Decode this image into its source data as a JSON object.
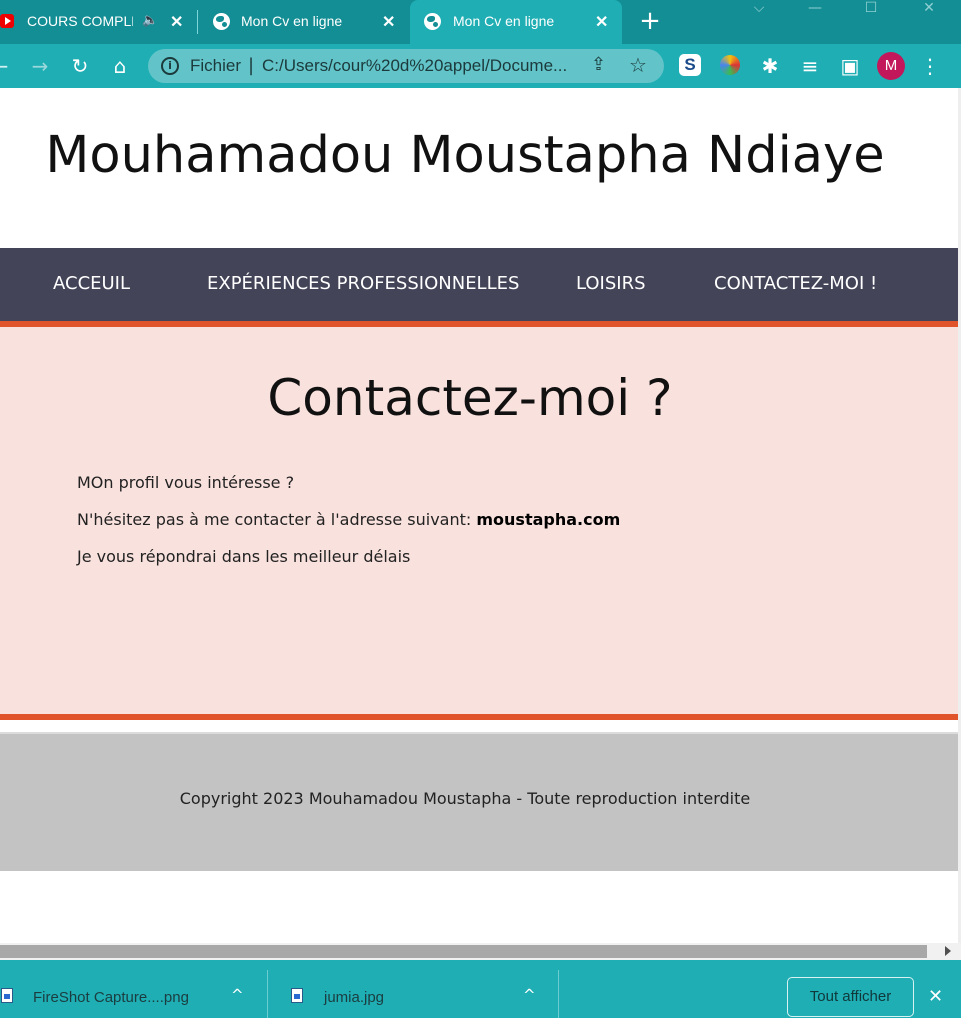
{
  "browser": {
    "tabs": [
      {
        "title": "COURS COMPLE",
        "audio_icon": "🔈",
        "close": "✕",
        "active": false
      },
      {
        "title": "Mon Cv en ligne",
        "close": "✕",
        "active": false
      },
      {
        "title": "Mon Cv en ligne",
        "close": "✕",
        "active": true
      }
    ],
    "new_tab": "+",
    "window_controls": {
      "dropdown": "⌵",
      "minimize": "—",
      "maximize": "☐",
      "close": "✕"
    },
    "nav": {
      "back": "←",
      "forward": "→",
      "reload": "↻",
      "home": "⌂"
    },
    "omnibox": {
      "info": "i",
      "scheme": "Fichier",
      "separator": "|",
      "url": "C:/Users/cour%20d%20appel/Docume..."
    },
    "extensions": {
      "s_ext": "S",
      "puzzle": "✱",
      "media": "≡",
      "sidebar": "▣",
      "menu": "⋮"
    },
    "profile_initial": "M",
    "colors": {
      "tabstrip": "#138e94",
      "toolbar": "#1eaeb4",
      "avatar": "#c2185b"
    }
  },
  "site": {
    "title": "Mouhamadou Moustapha Ndiaye",
    "nav": [
      "ACCEUIL",
      "EXPÉRIENCES PROFESSIONNELLES",
      "LOISIRS",
      "CONTACTEZ-MOI !"
    ],
    "contact": {
      "heading": "Contactez-moi ?",
      "line1": "MOn profil vous intéresse ?",
      "line2_prefix": "N'hésitez pas à me contacter à l'adresse suivant: ",
      "email": "moustapha.com",
      "line3": "Je vous répondrai dans les meilleur délais"
    },
    "footer": "Copyright 2023 Mouhamadou Moustapha - Toute reproduction interdite",
    "colors": {
      "nav_bg": "#434458",
      "accent": "#e1542b",
      "contact_bg": "#f9e1dd",
      "footer_bg": "#c3c3c3"
    }
  },
  "downloads": {
    "items": [
      {
        "name": "FireShot Capture....png",
        "chevron": "^"
      },
      {
        "name": "jumia.jpg",
        "chevron": "^"
      }
    ],
    "show_all": "Tout afficher",
    "close": "✕"
  }
}
